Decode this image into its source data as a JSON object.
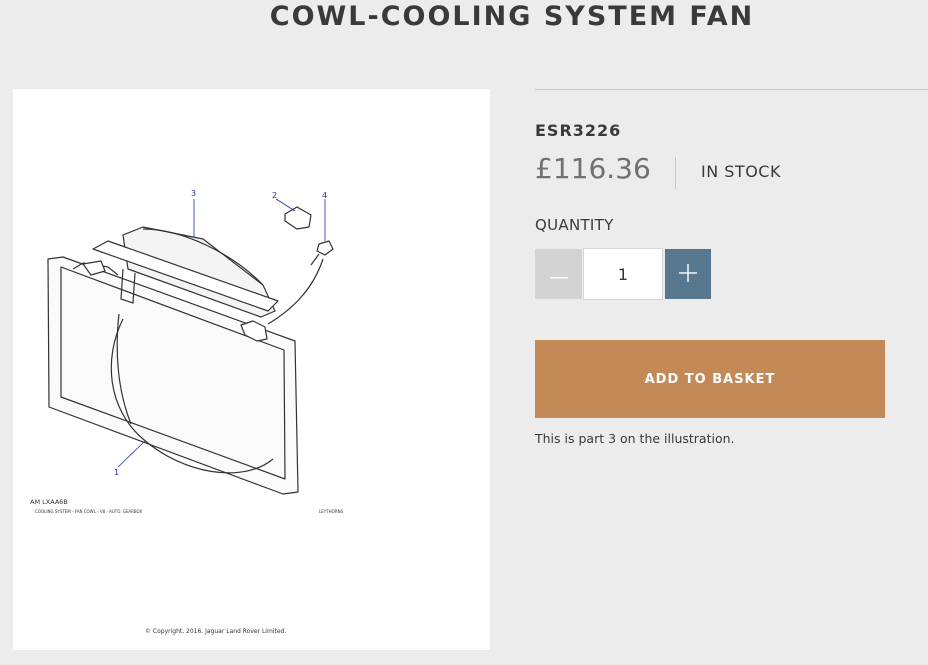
{
  "product": {
    "title": "COWL-COOLING SYSTEM FAN",
    "sku": "ESR3226",
    "price": "£116.36",
    "stock_status": "IN STOCK",
    "note": "This is part 3 on the illustration."
  },
  "quantity": {
    "label": "QUANTITY",
    "value": "1",
    "decrease_icon": "minus-icon",
    "increase_icon": "plus-icon"
  },
  "actions": {
    "add_to_basket": "ADD TO BASKET"
  },
  "illustration": {
    "callouts": [
      "3",
      "2",
      "4",
      "1"
    ],
    "code": "AM LXAA6B",
    "caption": "COOLING SYSTEM - FAN COWL - V8 - AUTO. GEARBOX",
    "side_code": "LEYTHORNS",
    "copyright": "© Copyright, 2016. Jaguar Land Rover Limited."
  },
  "colors": {
    "background": "#ececec",
    "accent_button": "#c38a57",
    "plus_button": "#587890",
    "minus_button": "#d3d3d3",
    "callout_number": "#1a2fa8"
  }
}
